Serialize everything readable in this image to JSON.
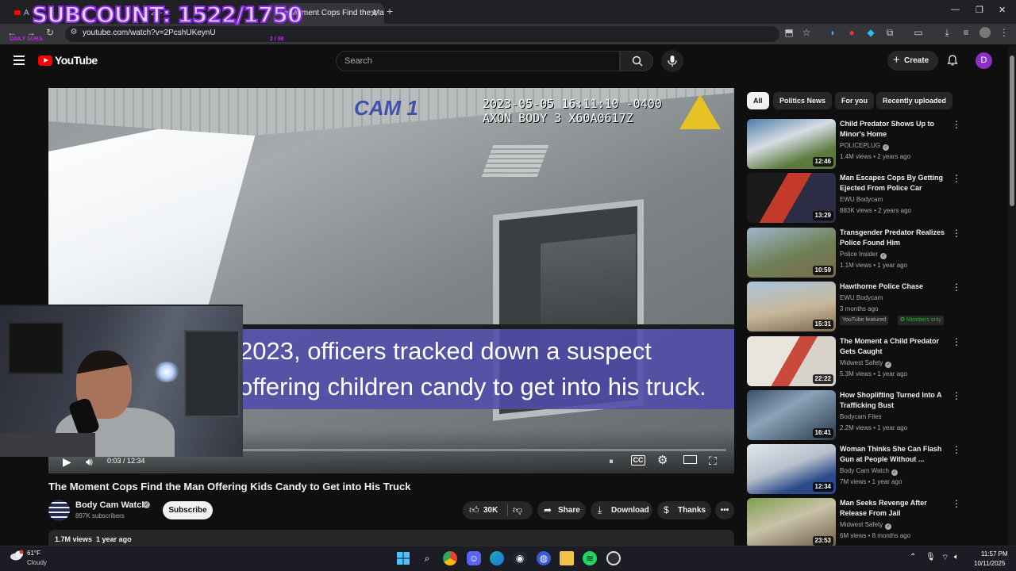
{
  "browser": {
    "tabs": [
      {
        "title": "A"
      },
      {
        "title": "20-"
      },
      {
        "title": "The Moment Cops Find the Man Off..."
      }
    ],
    "url": "youtube.com/watch?v=2PcshUKeynU",
    "new_tab_icon": "plus-icon"
  },
  "stream_overlay": {
    "subcount": "SUBCOUNT: 1522/1750",
    "daily_subs_label": "DAILY SUBS",
    "daily_subs_count": "2 / 50",
    "daily_subs_progress": 0.04
  },
  "youtube": {
    "wordmark": "YouTube",
    "search_placeholder": "Search",
    "create_label": "Create",
    "avatar_letter": "D"
  },
  "player": {
    "cam_logo": "CAM 1",
    "cam_timestamp": "2023-05-05 16:11:10 -0400\nAXON BODY 3 X60A0617Z",
    "caption": "2023, officers tracked down a suspect offering children candy to get into his truck.",
    "time": "0:03 / 12:34",
    "progress": 0.004
  },
  "video": {
    "title": "The Moment Cops Find the Man Offering Kids Candy to Get into His Truck",
    "channel": "Body Cam Watch",
    "subscribers": "897K subscribers",
    "subscribe_label": "Subscribe",
    "likes": "30K",
    "share_label": "Share",
    "download_label": "Download",
    "thanks_label": "Thanks",
    "views": "1.7M views",
    "date": "1 year ago"
  },
  "sidebar": {
    "chips": [
      "All",
      "Politics News",
      "For you",
      "Recently uploaded"
    ],
    "recommendations": [
      {
        "title": "Child Predator Shows Up to Minor's Home",
        "channel": "POLICEPLUG",
        "meta": "1.4M views • 2 years ago",
        "duration": "12:46",
        "verified": true
      },
      {
        "title": "Man Escapes Cops By Getting Ejected From Police Car",
        "channel": "EWU Bodycam",
        "meta": "883K views • 2 years ago",
        "duration": "13:29",
        "verified": false
      },
      {
        "title": "Transgender Predator Realizes Police Found Him",
        "channel": "Police Insider",
        "meta": "1.1M views • 1 year ago",
        "duration": "10:59",
        "verified": true
      },
      {
        "title": "Hawthorne Police Chase",
        "channel": "EWU Bodycam",
        "meta": "3 months ago",
        "duration": "15:31",
        "verified": false,
        "badges": [
          "YouTube featured",
          "Members only"
        ]
      },
      {
        "title": "The Moment a Child Predator Gets Caught",
        "channel": "Midwest Safety",
        "meta": "5.3M views • 1 year ago",
        "duration": "22:22",
        "verified": true
      },
      {
        "title": "How Shoplifting Turned Into A Trafficking Bust",
        "channel": "Bodycam Files",
        "meta": "2.2M views • 1 year ago",
        "duration": "16:41",
        "verified": false
      },
      {
        "title": "Woman Thinks She Can Flash Gun at People Without ...",
        "channel": "Body Cam Watch",
        "meta": "7M views • 1 year ago",
        "duration": "12:34",
        "verified": true
      },
      {
        "title": "Man Seeks Revenge After Release From Jail",
        "channel": "Midwest Safety",
        "meta": "6M views • 8 months ago",
        "duration": "23:53",
        "verified": true
      }
    ]
  },
  "taskbar": {
    "temperature": "61°F",
    "condition": "Cloudy",
    "time": "11:57 PM",
    "date": "10/11/2025",
    "apps": [
      "windows-start-icon",
      "search-icon",
      "chrome-icon",
      "discord-icon",
      "edge-icon",
      "steam-icon",
      "browser-icon",
      "file-explorer-icon",
      "spotify-icon",
      "obs-icon"
    ]
  },
  "colors": {
    "youtube_red": "#ff0000",
    "overlay_purple": "#8a2be2",
    "avatar_purple": "#8b2fc9",
    "caption_band": "#4e4caa"
  }
}
